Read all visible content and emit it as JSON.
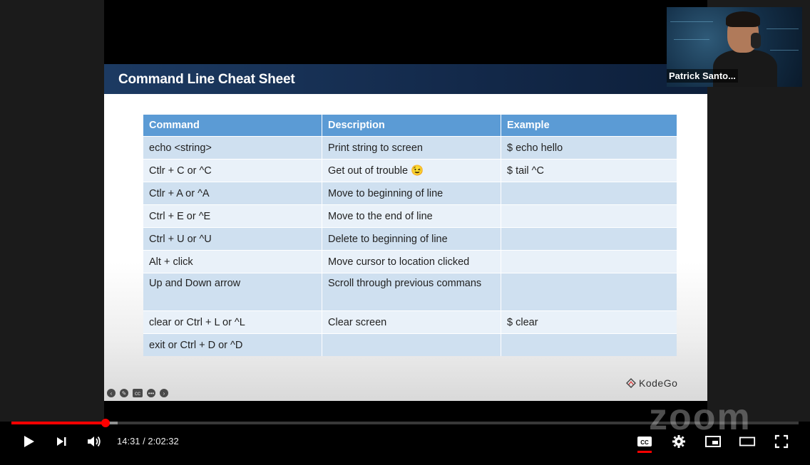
{
  "slide": {
    "title": "Command Line Cheat Sheet",
    "table": {
      "headers": [
        "Command",
        "Description",
        "Example"
      ],
      "rows": [
        {
          "command": "echo <string>",
          "description": "Print string to screen",
          "example": "$ echo hello"
        },
        {
          "command": "Ctlr + C or ^C",
          "description": "Get out of trouble 😉",
          "example": "$ tail ^C"
        },
        {
          "command": "Ctlr + A or ^A",
          "description": "Move to beginning of line",
          "example": ""
        },
        {
          "command": "Ctrl + E or ^E",
          "description": "Move to the end of line",
          "example": ""
        },
        {
          "command": "Ctrl + U or ^U",
          "description": "Delete to beginning of line",
          "example": ""
        },
        {
          "command": "Alt + click",
          "description": "Move cursor to location clicked",
          "example": ""
        },
        {
          "command": "Up and Down arrow",
          "description": "Scroll through previous commans",
          "example": ""
        },
        {
          "command": "clear or Ctrl + L or ^L",
          "description": "Clear screen",
          "example": "$ clear"
        },
        {
          "command": "exit or Ctrl + D or ^D",
          "description": "",
          "example": ""
        }
      ]
    },
    "logo_text": "KodeGo"
  },
  "webcam": {
    "name": "Patrick Santo..."
  },
  "watermark": "zoom",
  "player": {
    "current_time": "14:31",
    "duration": "2:02:32",
    "time_display": "14:31 / 2:02:32",
    "progress_fraction": 0.1199,
    "buffered_fraction": 0.135,
    "accent_color": "#ff0000",
    "icons": [
      "play-icon",
      "next-icon",
      "volume-icon",
      "captions-icon",
      "settings-icon",
      "miniplayer-icon",
      "theater-icon",
      "fullscreen-icon"
    ]
  }
}
